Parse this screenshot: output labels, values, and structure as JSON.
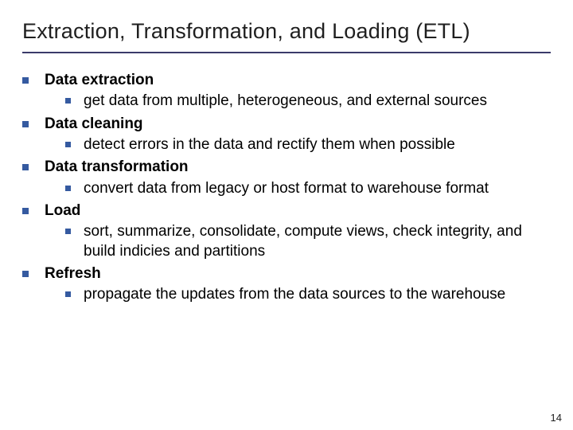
{
  "title": "Extraction, Transformation, and Loading (ETL)",
  "items": [
    {
      "heading": "Data extraction",
      "sub": [
        "get data from multiple, heterogeneous, and external sources"
      ]
    },
    {
      "heading": "Data cleaning",
      "sub": [
        "detect errors in the data and rectify them when possible"
      ]
    },
    {
      "heading": "Data transformation",
      "sub": [
        "convert data from legacy or host format to warehouse format"
      ]
    },
    {
      "heading": "Load",
      "sub": [
        "sort, summarize, consolidate, compute views, check integrity, and build indicies and partitions"
      ]
    },
    {
      "heading": "Refresh",
      "sub": [
        "propagate the updates from the data sources to the warehouse"
      ]
    }
  ],
  "page_number": "14"
}
